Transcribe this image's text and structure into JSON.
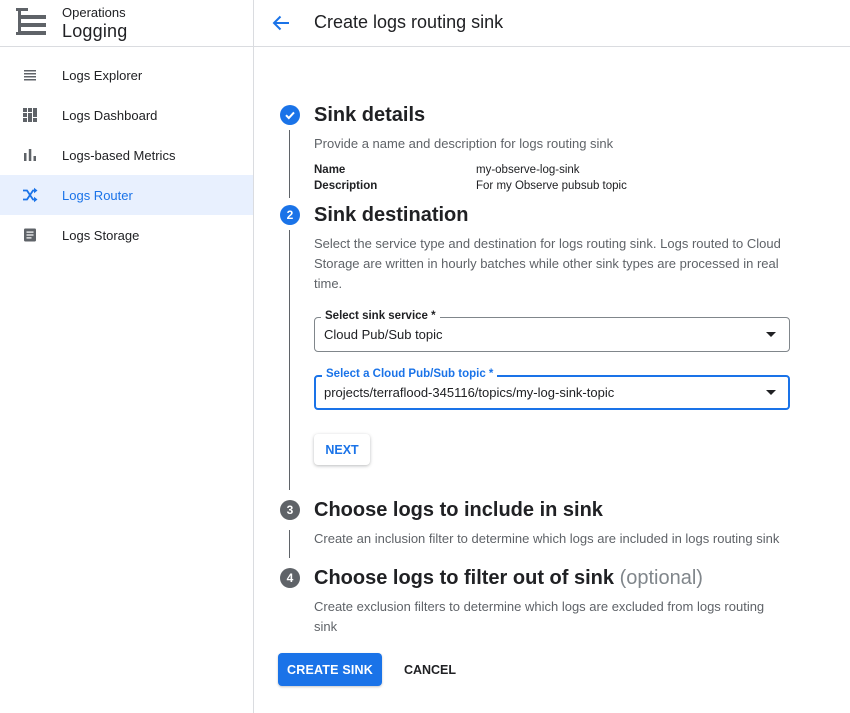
{
  "sidebar": {
    "product": "Operations",
    "app_name": "Logging",
    "items": [
      {
        "label": "Logs Explorer",
        "icon": "list-icon"
      },
      {
        "label": "Logs Dashboard",
        "icon": "dashboard-icon"
      },
      {
        "label": "Logs-based Metrics",
        "icon": "bar-chart-icon"
      },
      {
        "label": "Logs Router",
        "icon": "shuffle-icon",
        "active": true
      },
      {
        "label": "Logs Storage",
        "icon": "storage-icon"
      }
    ]
  },
  "header": {
    "title": "Create logs routing sink",
    "back_icon": "arrow-back-icon"
  },
  "steps": [
    {
      "status": "completed",
      "title": "Sink details",
      "description": "Provide a name and description for logs routing sink",
      "fields": [
        {
          "label": "Name",
          "value": "my-observe-log-sink"
        },
        {
          "label": "Description",
          "value": "For my Observe pubsub topic"
        }
      ]
    },
    {
      "number": "2",
      "status": "active",
      "title": "Sink destination",
      "description": "Select the service type and destination for logs routing sink. Logs routed to Cloud Storage are written in hourly batches while other sink types are processed in real time.",
      "service_select": {
        "label": "Select sink service *",
        "value": "Cloud Pub/Sub topic"
      },
      "topic_select": {
        "label": "Select a Cloud Pub/Sub topic *",
        "value": "projects/terraflood-345116/topics/my-log-sink-topic"
      },
      "next_label": "NEXT"
    },
    {
      "number": "3",
      "status": "pending",
      "title": "Choose logs to include in sink",
      "description": "Create an inclusion filter to determine which logs are included in logs routing sink"
    },
    {
      "number": "4",
      "status": "pending",
      "title": "Choose logs to filter out of sink",
      "title_suffix": "(optional)",
      "description": "Create exclusion filters to determine which logs are excluded from logs routing sink"
    }
  ],
  "actions": {
    "create_label": "CREATE SINK",
    "cancel_label": "CANCEL"
  },
  "colors": {
    "accent": "#1a73e8",
    "active_bg": "#e8f0fe",
    "pending_step": "#5f6368"
  }
}
